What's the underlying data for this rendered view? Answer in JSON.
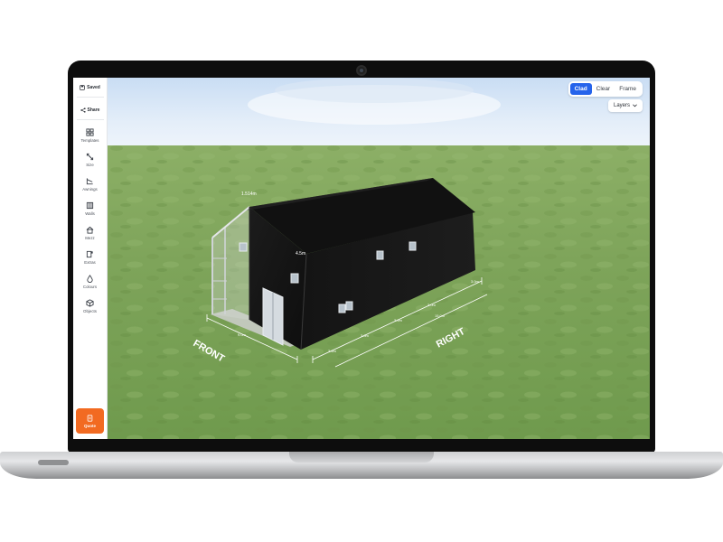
{
  "sidebar": {
    "saved_label": "Saved",
    "share_label": "Share",
    "items": [
      {
        "label": "Templates",
        "icon": "grid-icon"
      },
      {
        "label": "Size",
        "icon": "resize-icon"
      },
      {
        "label": "Awnings",
        "icon": "awning-icon"
      },
      {
        "label": "Walls",
        "icon": "walls-icon"
      },
      {
        "label": "Mezz",
        "icon": "house-icon"
      },
      {
        "label": "Extras",
        "icon": "extras-icon"
      },
      {
        "label": "Colours",
        "icon": "droplet-icon"
      },
      {
        "label": "Objects",
        "icon": "cube-icon"
      }
    ],
    "quote_label": "Quote"
  },
  "toolbar": {
    "view_modes": [
      "Clad",
      "Clear",
      "Frame"
    ],
    "active_mode": "Clad",
    "layers_label": "Layers"
  },
  "scene": {
    "front_label": "FRONT",
    "right_label": "RIGHT",
    "dimensions": {
      "apex_height": "1.514m",
      "eave_height": "4.5m",
      "front_width": "9.0m",
      "bay_1": "3.6m",
      "bay_2": "3.0m",
      "bay_3": "3.0m",
      "bay_4": "3.0m",
      "bay_5": "3.0m",
      "total_length": "15.0m"
    }
  },
  "colors": {
    "accent_blue": "#2563eb",
    "quote_orange": "#f26a21",
    "building_cladding": "#161616",
    "grass": "#7fa45a"
  }
}
